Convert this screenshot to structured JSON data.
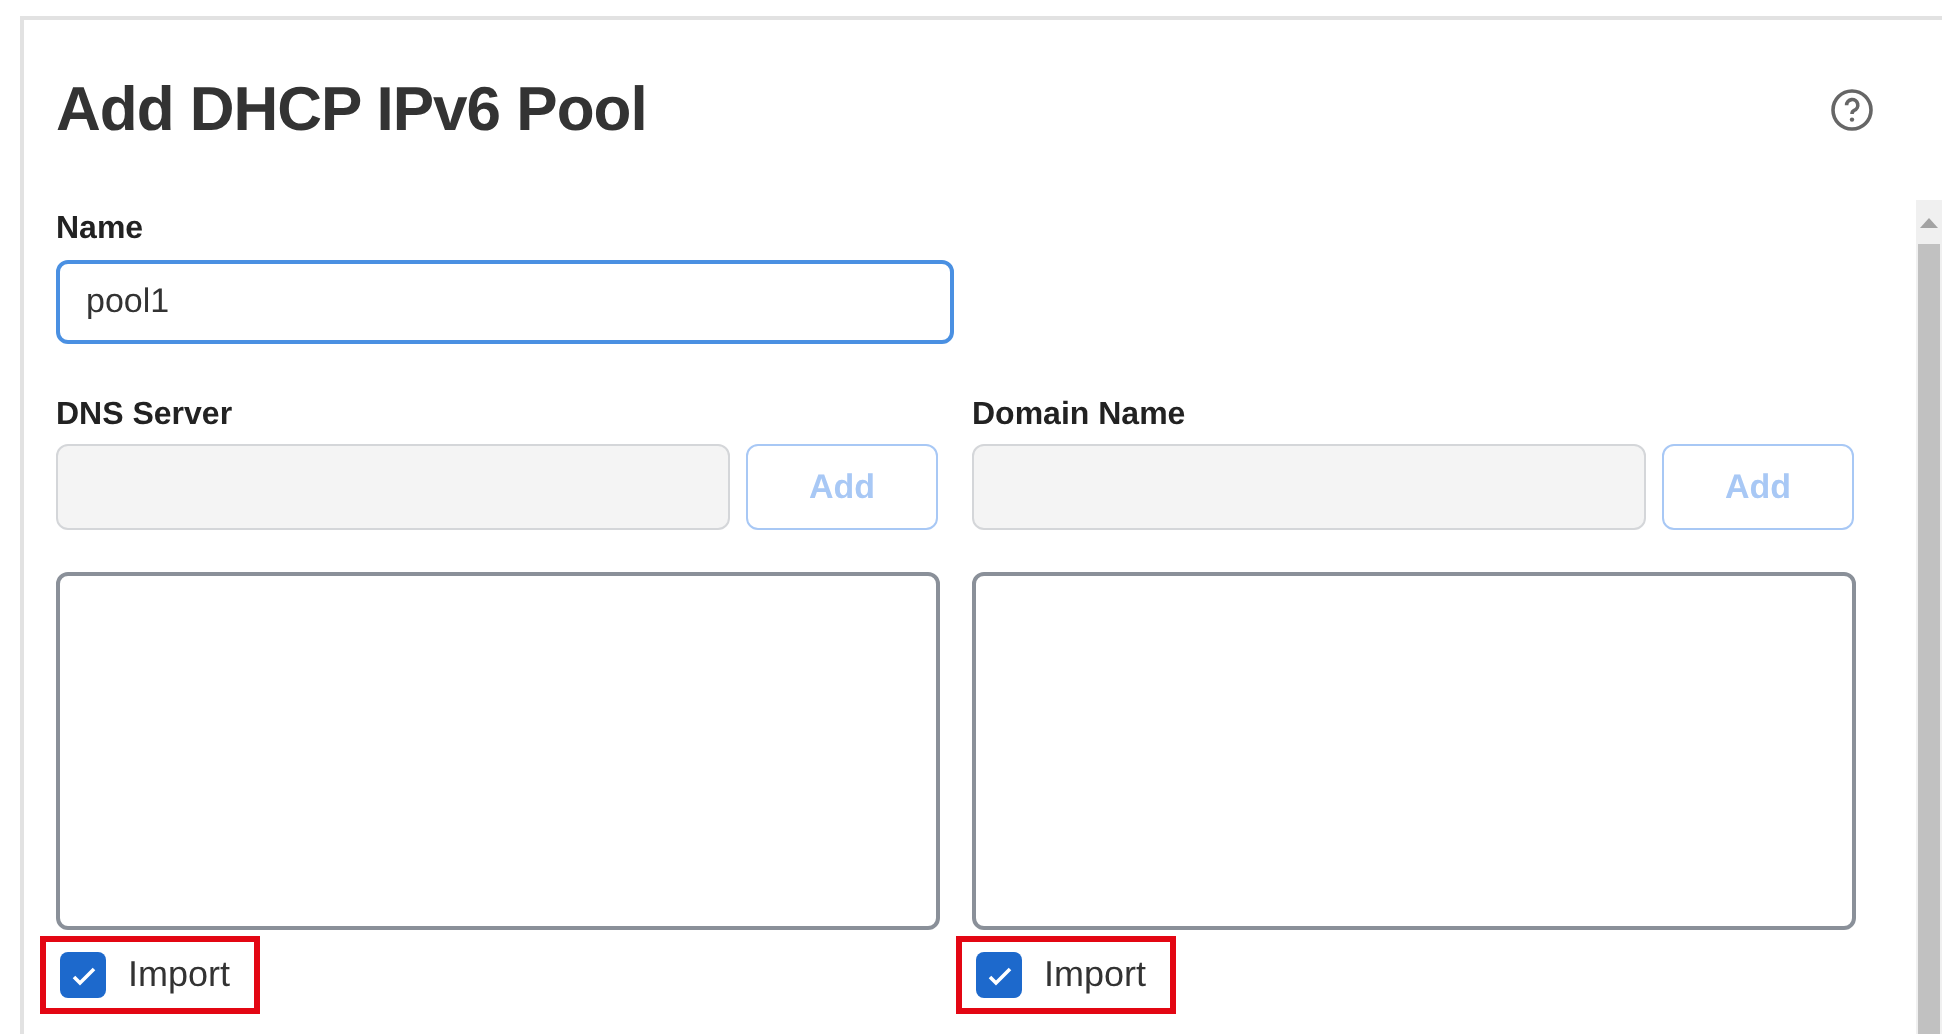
{
  "dialog": {
    "title": "Add DHCP IPv6 Pool"
  },
  "name_field": {
    "label": "Name",
    "value": "pool1",
    "focused": true
  },
  "columns": [
    {
      "label": "DNS Server",
      "add_button": "Add",
      "add_disabled": true,
      "import": {
        "label": "Import",
        "checked": true,
        "highlighted": true
      }
    },
    {
      "label": "Domain Name",
      "add_button": "Add",
      "add_disabled": true,
      "import": {
        "label": "Import",
        "checked": true,
        "highlighted": true
      }
    }
  ]
}
